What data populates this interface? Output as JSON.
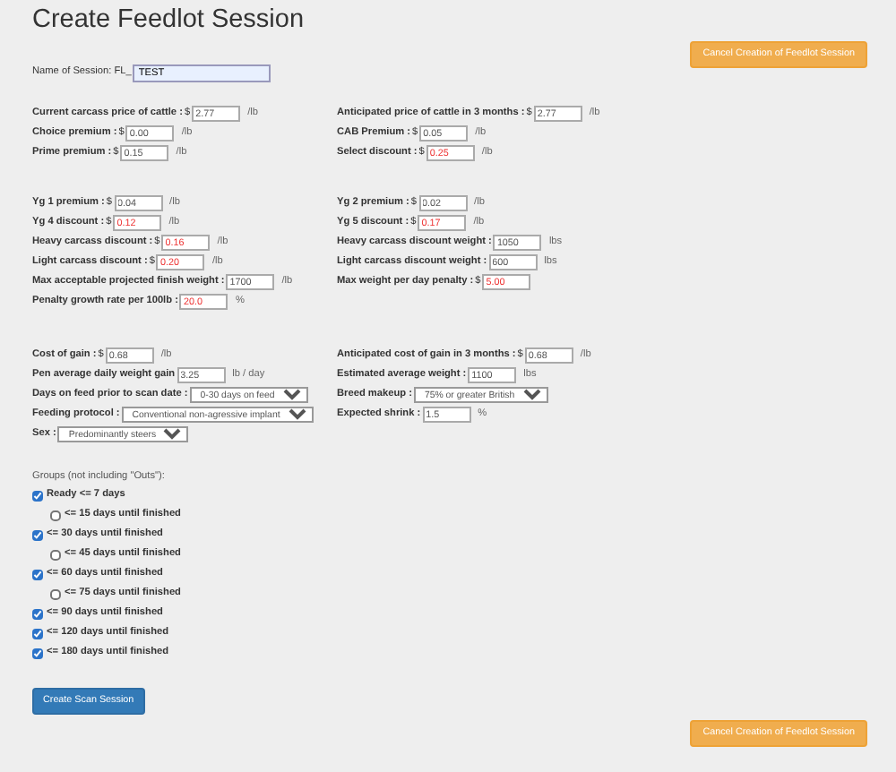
{
  "title": "Create Feedlot Session",
  "cancel_top": "Cancel Creation of Feedlot Session",
  "session_name": {
    "label": "Name of Session: FL_",
    "value": "TEST"
  },
  "sections": [
    {
      "left": [
        {
          "kind": "input",
          "label": "Current carcass price of cattle :",
          "prefix": "$",
          "value": "2.77",
          "unit": "/lb",
          "negative": false
        },
        {
          "kind": "input",
          "label": "Choice premium :",
          "prefix": "$",
          "value": "0.00",
          "unit": "/lb",
          "negative": false
        },
        {
          "kind": "input",
          "label": "Prime premium :",
          "prefix": "$",
          "value": "0.15",
          "unit": "/lb",
          "negative": false
        }
      ],
      "right": [
        {
          "kind": "input",
          "label": "Anticipated price of cattle in 3 months :",
          "prefix": "$",
          "value": "2.77",
          "unit": "/lb",
          "negative": false
        },
        {
          "kind": "input",
          "label": "CAB Premium :",
          "prefix": "$",
          "value": "0.05",
          "unit": "/lb",
          "negative": false
        },
        {
          "kind": "input",
          "label": "Select discount :",
          "prefix": "$",
          "value": "0.25",
          "unit": "/lb",
          "negative": true
        }
      ]
    },
    {
      "left": [
        {
          "kind": "input",
          "label": "Yg 1 premium :",
          "prefix": "$",
          "value": "0.04",
          "unit": "/lb",
          "negative": false
        },
        {
          "kind": "input",
          "label": "Yg 4 discount :",
          "prefix": "$",
          "value": "0.12",
          "unit": "/lb",
          "negative": true
        },
        {
          "kind": "input",
          "label": "Heavy carcass discount :",
          "prefix": "$",
          "value": "0.16",
          "unit": "/lb",
          "negative": true
        },
        {
          "kind": "input",
          "label": "Light carcass discount :",
          "prefix": "$",
          "value": "0.20",
          "unit": "/lb",
          "negative": true
        },
        {
          "kind": "input",
          "label": "Max acceptable projected finish weight :",
          "value": "1700",
          "unit": "/lb",
          "negative": false
        },
        {
          "kind": "input",
          "label": "Penalty growth rate per 100lb :",
          "value": "20.0",
          "unit": "%",
          "negative": true
        }
      ],
      "right": [
        {
          "kind": "input",
          "label": "Yg 2 premium :",
          "prefix": "$",
          "value": "0.02",
          "unit": "/lb",
          "negative": false
        },
        {
          "kind": "input",
          "label": "Yg 5 discount :",
          "prefix": "$",
          "value": "0.17",
          "unit": "/lb",
          "negative": true
        },
        {
          "kind": "input",
          "label": "Heavy carcass discount weight :",
          "value": "1050",
          "unit": "lbs",
          "negative": false
        },
        {
          "kind": "input",
          "label": "Light carcass discount weight :",
          "value": "600",
          "unit": "lbs",
          "negative": false
        },
        {
          "kind": "input",
          "label": "Max weight per day penalty :",
          "prefix": "$",
          "value": "5.00",
          "negative": true
        }
      ]
    },
    {
      "left": [
        {
          "kind": "input",
          "label": "Cost of gain :",
          "prefix": "$",
          "value": "0.68",
          "unit": "/lb",
          "negative": false
        },
        {
          "kind": "input",
          "label": "Pen average daily weight gain",
          "value": "3.25",
          "unit": "lb / day",
          "negative": false
        },
        {
          "kind": "select",
          "label": "Days on feed prior to scan date :",
          "value": "0-30 days on feed"
        },
        {
          "kind": "select",
          "label": "Feeding protocol :",
          "value": "Conventional non-agressive implant"
        },
        {
          "kind": "select",
          "label": "Sex :",
          "value": "Predominantly steers"
        }
      ],
      "right": [
        {
          "kind": "input",
          "label": "Anticipated cost of gain in 3 months :",
          "prefix": "$",
          "value": "0.68",
          "unit": "/lb",
          "negative": false
        },
        {
          "kind": "input",
          "label": "Estimated average weight :",
          "value": "1100",
          "unit": "lbs",
          "negative": false
        },
        {
          "kind": "select",
          "label": "Breed makeup :",
          "value": "75% or greater British"
        },
        {
          "kind": "input",
          "label": "Expected shrink :",
          "value": "1.5",
          "unit": "%",
          "negative": false
        }
      ]
    }
  ],
  "groups_label": "Groups (not including \"Outs\"):",
  "groups": [
    {
      "label": "Ready <= 7 days",
      "checked": true,
      "children": [
        {
          "label": "<= 15 days until finished",
          "checked": false
        }
      ]
    },
    {
      "label": "<= 30 days until finished",
      "checked": true,
      "children": [
        {
          "label": "<= 45 days until finished",
          "checked": false
        }
      ]
    },
    {
      "label": "<= 60 days until finished",
      "checked": true,
      "children": [
        {
          "label": "<= 75 days until finished",
          "checked": false
        }
      ]
    },
    {
      "label": "<= 90 days until finished",
      "checked": true
    },
    {
      "label": "<= 120 days until finished",
      "checked": true
    },
    {
      "label": "<= 180 days until finished",
      "checked": true
    }
  ],
  "create_button": "Create Scan Session",
  "cancel_bottom": "Cancel Creation of Feedlot Session"
}
